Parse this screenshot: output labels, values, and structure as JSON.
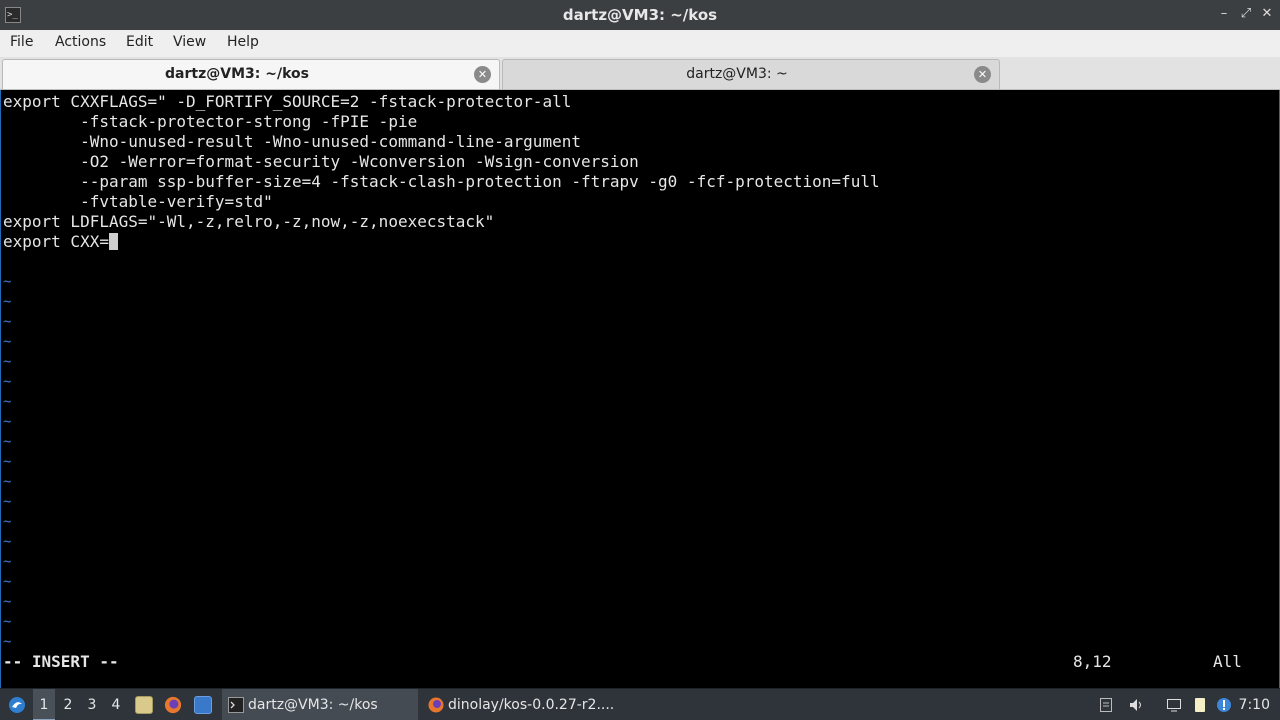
{
  "window": {
    "title": "dartz@VM3: ~/kos",
    "app_icon_glyph": ">_",
    "minimize_glyph": "–",
    "maximize_glyph": "⤢",
    "close_glyph": "✕"
  },
  "menu": {
    "file": "File",
    "actions": "Actions",
    "edit": "Edit",
    "view": "View",
    "help": "Help"
  },
  "tabs": [
    {
      "label": "dartz@VM3: ~/kos",
      "active": true,
      "close_glyph": "✕"
    },
    {
      "label": "dartz@VM3: ~",
      "active": false,
      "close_glyph": "✕"
    }
  ],
  "editor": {
    "lines": [
      "export CXXFLAGS=\" -D_FORTIFY_SOURCE=2 -fstack-protector-all",
      "        -fstack-protector-strong -fPIE -pie",
      "        -Wno-unused-result -Wno-unused-command-line-argument",
      "        -O2 -Werror=format-security -Wconversion -Wsign-conversion",
      "        --param ssp-buffer-size=4 -fstack-clash-protection -ftrapv -g0 -fcf-protection=full",
      "        -fvtable-verify=std\"",
      "export LDFLAGS=\"-Wl,-z,relro,-z,now,-z,noexecstack\"",
      "export CXX="
    ],
    "tilde": "~",
    "mode": "-- INSERT --",
    "cursor_position": "8,12",
    "scroll_indicator": "All"
  },
  "taskbar": {
    "workspaces": [
      "1",
      "2",
      "3",
      "4"
    ],
    "active_workspace": "1",
    "tasks": [
      {
        "label": "dartz@VM3: ~/kos",
        "icon": "terminal-icon",
        "active": true
      },
      {
        "label": "dinolay/kos-0.0.27-r2....",
        "icon": "firefox-icon",
        "active": false
      }
    ],
    "clock": "7:10",
    "colors": {
      "accent": "#1e6bb8",
      "tilde": "#3d78c2"
    }
  }
}
